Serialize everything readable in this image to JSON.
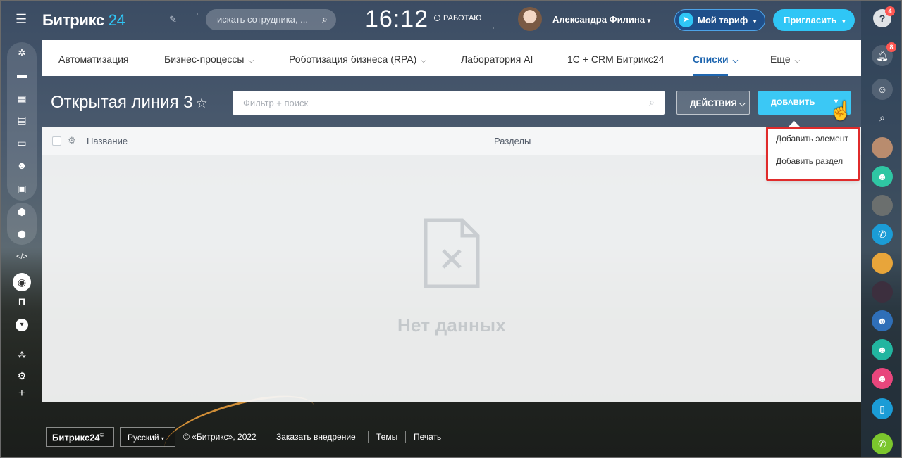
{
  "header": {
    "logo_main": "Битрикс",
    "logo_num": "24",
    "search_placeholder": "искать сотрудника, ...",
    "clock": "16:12",
    "work_status": "РАБОТАЮ",
    "user_name": "Александра Филина",
    "tariff_label": "Мой тариф",
    "invite_label": "Пригласить"
  },
  "menu": {
    "items": [
      {
        "label": "Автоматизация",
        "dropdown": false
      },
      {
        "label": "Бизнес-процессы",
        "dropdown": true
      },
      {
        "label": "Роботизация бизнеса (RPA)",
        "dropdown": true
      },
      {
        "label": "Лаборатория AI",
        "dropdown": false
      },
      {
        "label": "1С + CRM Битрикс24",
        "dropdown": false
      },
      {
        "label": "Списки",
        "dropdown": true,
        "active": true
      },
      {
        "label": "Еще",
        "dropdown": true
      }
    ]
  },
  "page": {
    "title": "Открытая линия 3",
    "filter_placeholder": "Фильтр + поиск",
    "actions_label": "ДЕЙСТВИЯ",
    "add_label": "ДОБАВИТЬ"
  },
  "grid": {
    "columns": [
      "Название",
      "Разделы"
    ],
    "empty_text": "Нет данных"
  },
  "add_menu": {
    "items": [
      "Добавить элемент",
      "Добавить раздел"
    ]
  },
  "rightbar": {
    "help_badge": "4",
    "notify_badge": "8"
  },
  "leftbar": {
    "letter": "П"
  },
  "footer": {
    "logo": "Битрикс24",
    "logo_mark": "©",
    "language": "Русский",
    "copyright": "© «Битрикс», 2022",
    "order": "Заказать внедрение",
    "themes": "Темы",
    "print": "Печать"
  },
  "colors": {
    "accent": "#2fc6f6",
    "active_menu": "#2067b0",
    "highlight": "#e02b2b"
  }
}
